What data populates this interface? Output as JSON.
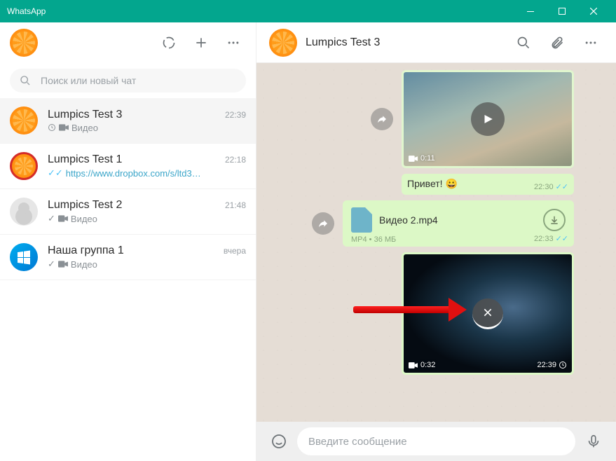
{
  "titlebar": {
    "title": "WhatsApp"
  },
  "search": {
    "placeholder": "Поиск или новый чат"
  },
  "chats": [
    {
      "name": "Lumpics Test 3",
      "time": "22:39",
      "preview": "Видео",
      "status": "clock",
      "active": true,
      "avatar": "orange"
    },
    {
      "name": "Lumpics Test 1",
      "time": "22:18",
      "preview": "https://www.dropbox.com/s/ltd3…",
      "status": "read",
      "avatar": "orange-red",
      "link": true
    },
    {
      "name": "Lumpics Test 2",
      "time": "21:48",
      "preview": "Видео",
      "status": "sent",
      "avatar": "gray"
    },
    {
      "name": "Наша группа 1",
      "time": "вчера",
      "preview": "Видео",
      "status": "sent",
      "avatar": "windows"
    }
  ],
  "header": {
    "title": "Lumpics Test 3"
  },
  "msgs": {
    "video1": {
      "duration": "0:11"
    },
    "text1": {
      "text": "Привет! 😀",
      "time": "22:30"
    },
    "file1": {
      "name": "Видео 2.mp4",
      "meta": "MP4 • 36 МБ",
      "time": "22:33"
    },
    "video2": {
      "duration": "0:32",
      "time": "22:39"
    }
  },
  "input": {
    "placeholder": "Введите сообщение"
  }
}
